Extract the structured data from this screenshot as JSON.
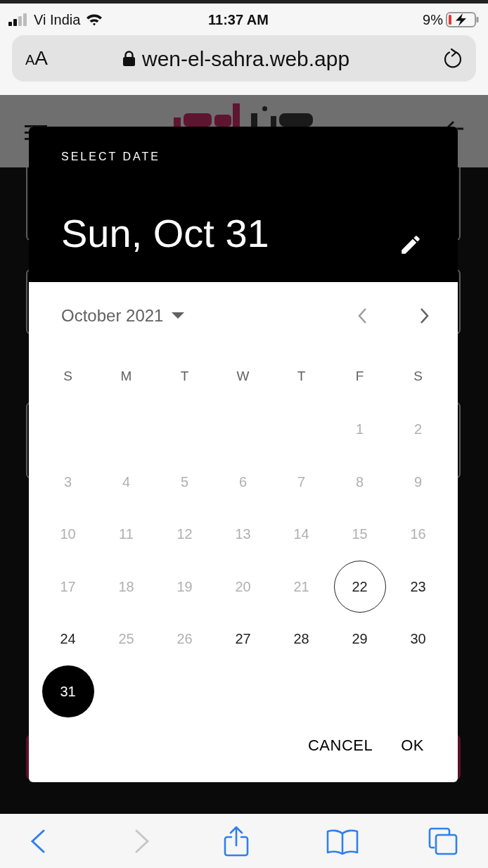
{
  "status_bar": {
    "carrier": "Vi India",
    "time": "11:37 AM",
    "battery": "9%",
    "charging": true
  },
  "address_bar": {
    "text_size_button": "AA",
    "url": "wen-el-sahra.web.app",
    "secure": true
  },
  "date_picker": {
    "title": "SELECT DATE",
    "heading": "Sun, Oct 31",
    "month": "October 2021",
    "weekdays": [
      "S",
      "M",
      "T",
      "W",
      "T",
      "F",
      "S"
    ],
    "weeks": [
      [
        {
          "kind": "empty"
        },
        {
          "kind": "empty"
        },
        {
          "kind": "empty"
        },
        {
          "kind": "empty"
        },
        {
          "kind": "empty"
        },
        {
          "kind": "day",
          "day": "1",
          "disabled": true,
          "selected": false,
          "today": false
        },
        {
          "kind": "day",
          "day": "2",
          "disabled": true,
          "selected": false,
          "today": false
        }
      ],
      [
        {
          "kind": "day",
          "day": "3",
          "disabled": true,
          "selected": false,
          "today": false
        },
        {
          "kind": "day",
          "day": "4",
          "disabled": true,
          "selected": false,
          "today": false
        },
        {
          "kind": "day",
          "day": "5",
          "disabled": true,
          "selected": false,
          "today": false
        },
        {
          "kind": "day",
          "day": "6",
          "disabled": true,
          "selected": false,
          "today": false
        },
        {
          "kind": "day",
          "day": "7",
          "disabled": true,
          "selected": false,
          "today": false
        },
        {
          "kind": "day",
          "day": "8",
          "disabled": true,
          "selected": false,
          "today": false
        },
        {
          "kind": "day",
          "day": "9",
          "disabled": true,
          "selected": false,
          "today": false
        }
      ],
      [
        {
          "kind": "day",
          "day": "10",
          "disabled": true,
          "selected": false,
          "today": false
        },
        {
          "kind": "day",
          "day": "11",
          "disabled": true,
          "selected": false,
          "today": false
        },
        {
          "kind": "day",
          "day": "12",
          "disabled": true,
          "selected": false,
          "today": false
        },
        {
          "kind": "day",
          "day": "13",
          "disabled": true,
          "selected": false,
          "today": false
        },
        {
          "kind": "day",
          "day": "14",
          "disabled": true,
          "selected": false,
          "today": false
        },
        {
          "kind": "day",
          "day": "15",
          "disabled": true,
          "selected": false,
          "today": false
        },
        {
          "kind": "day",
          "day": "16",
          "disabled": true,
          "selected": false,
          "today": false
        }
      ],
      [
        {
          "kind": "day",
          "day": "17",
          "disabled": true,
          "selected": false,
          "today": false
        },
        {
          "kind": "day",
          "day": "18",
          "disabled": true,
          "selected": false,
          "today": false
        },
        {
          "kind": "day",
          "day": "19",
          "disabled": true,
          "selected": false,
          "today": false
        },
        {
          "kind": "day",
          "day": "20",
          "disabled": true,
          "selected": false,
          "today": false
        },
        {
          "kind": "day",
          "day": "21",
          "disabled": true,
          "selected": false,
          "today": false
        },
        {
          "kind": "day",
          "day": "22",
          "disabled": false,
          "selected": false,
          "today": true
        },
        {
          "kind": "day",
          "day": "23",
          "disabled": false,
          "selected": false,
          "today": false
        }
      ],
      [
        {
          "kind": "day",
          "day": "24",
          "disabled": false,
          "selected": false,
          "today": false
        },
        {
          "kind": "day",
          "day": "25",
          "disabled": true,
          "selected": false,
          "today": false
        },
        {
          "kind": "day",
          "day": "26",
          "disabled": true,
          "selected": false,
          "today": false
        },
        {
          "kind": "day",
          "day": "27",
          "disabled": false,
          "selected": false,
          "today": false
        },
        {
          "kind": "day",
          "day": "28",
          "disabled": false,
          "selected": false,
          "today": false
        },
        {
          "kind": "day",
          "day": "29",
          "disabled": false,
          "selected": false,
          "today": false
        },
        {
          "kind": "day",
          "day": "30",
          "disabled": false,
          "selected": false,
          "today": false
        }
      ],
      [
        {
          "kind": "day",
          "day": "31",
          "disabled": false,
          "selected": true,
          "today": false
        }
      ]
    ],
    "actions": [
      "CANCEL",
      "OK"
    ]
  },
  "toolbar": {
    "back_disabled": false,
    "forward_disabled": true
  }
}
